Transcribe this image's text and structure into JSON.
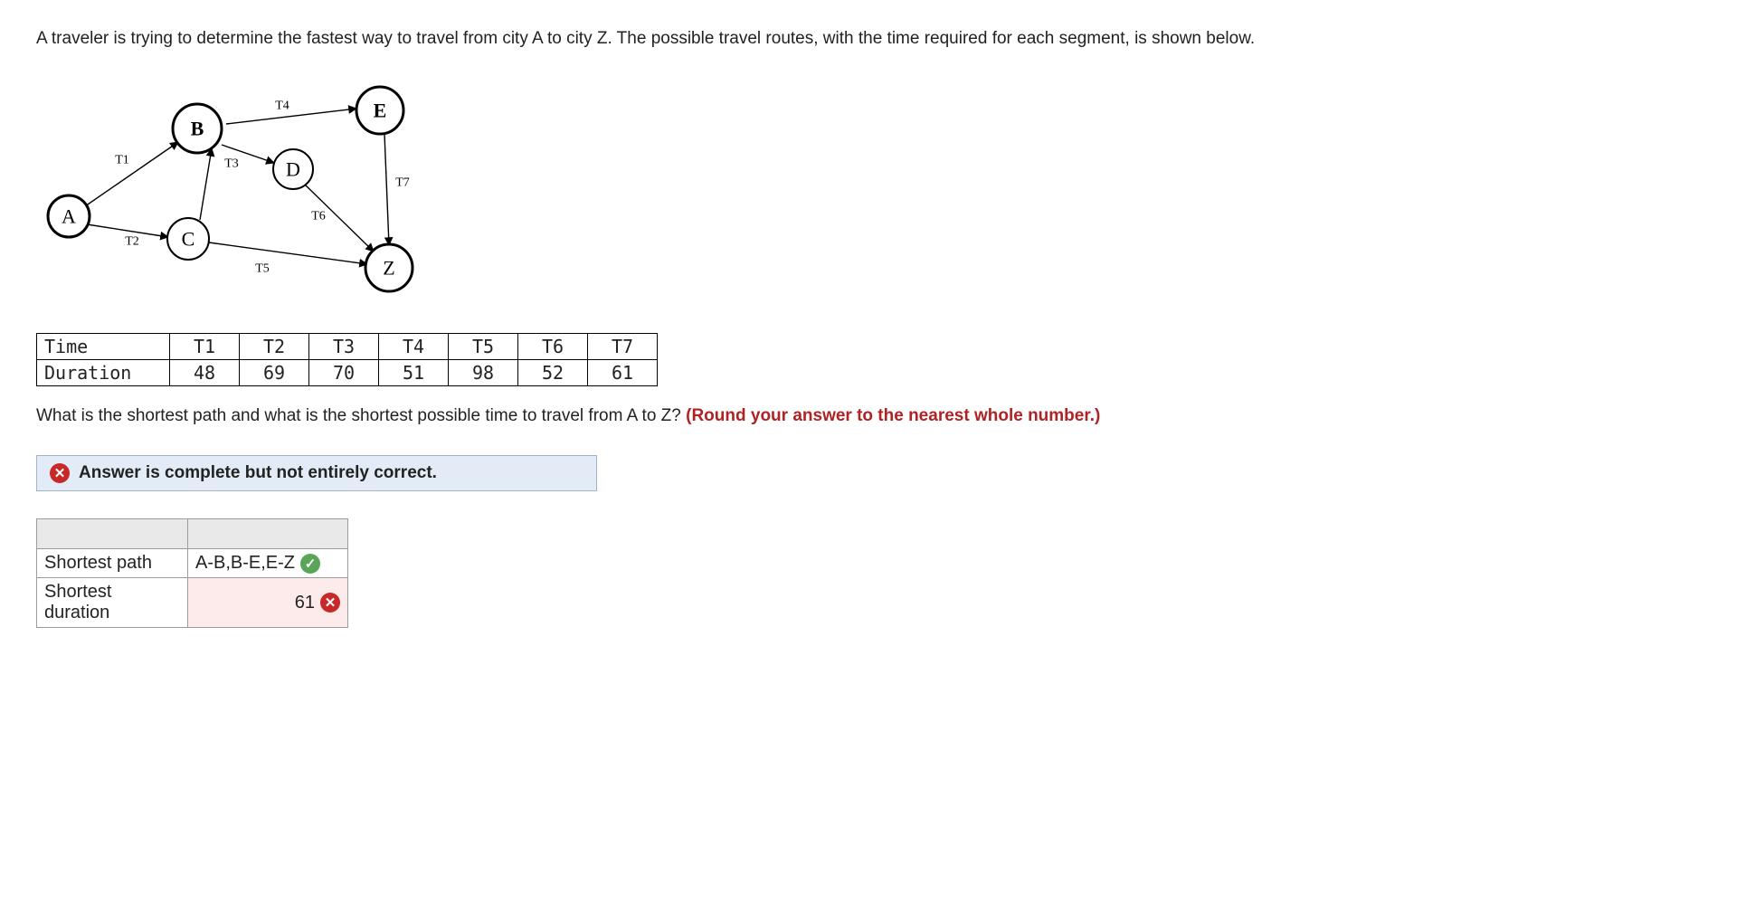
{
  "prompt": "A traveler is trying to determine the fastest way to travel from city A to city Z. The possible travel routes, with the time required for each segment, is shown below.",
  "graph": {
    "nodes": {
      "A": "A",
      "B": "B",
      "C": "C",
      "D": "D",
      "E": "E",
      "Z": "Z"
    },
    "edges": {
      "T1": "T1",
      "T2": "T2",
      "T3": "T3",
      "T4": "T4",
      "T5": "T5",
      "T6": "T6",
      "T7": "T7"
    }
  },
  "time_table": {
    "row1_label": "Time",
    "row2_label": "Duration",
    "headers": [
      "T1",
      "T2",
      "T3",
      "T4",
      "T5",
      "T6",
      "T7"
    ],
    "values": [
      "48",
      "69",
      "70",
      "51",
      "98",
      "52",
      "61"
    ]
  },
  "question": "What is the shortest path and what is the shortest possible time to travel from A to Z? ",
  "question_hint": "(Round your answer to the nearest whole number.)",
  "feedback": "Answer is complete but not entirely correct.",
  "answer_table": {
    "row1_label": "Shortest path",
    "row1_value": "A-B,B-E,E-Z",
    "row1_status": "correct",
    "row2_label": "Shortest duration",
    "row2_value": "61",
    "row2_status": "incorrect"
  }
}
